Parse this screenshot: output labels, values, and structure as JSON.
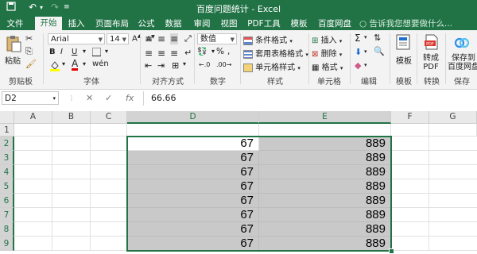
{
  "window": {
    "title": "百度问题统计 - Excel"
  },
  "quick_access": {
    "save_icon": "save-icon",
    "undo_icon": "undo-icon",
    "redo_icon": "redo-icon",
    "customize_icon": "customize-icon"
  },
  "tabs": [
    {
      "label": "文件"
    },
    {
      "label": "开始"
    },
    {
      "label": "插入"
    },
    {
      "label": "页面布局"
    },
    {
      "label": "公式"
    },
    {
      "label": "数据"
    },
    {
      "label": "审阅"
    },
    {
      "label": "视图"
    },
    {
      "label": "PDF工具"
    },
    {
      "label": "模板"
    },
    {
      "label": "百度网盘"
    }
  ],
  "tell_me": "告诉我您想要做什么...",
  "ribbon": {
    "paste_label": "粘贴",
    "font_name": "Arial",
    "font_size": "14",
    "number_format": "数值",
    "percent_symbol": "%",
    "conditional_format": "条件格式",
    "table_format": "套用表格格式",
    "cell_style": "单元格样式",
    "insert": "插入",
    "delete": "删除",
    "format": "格式",
    "template_label": "模板",
    "convert_pdf": "转成\nPDF",
    "save_to_baidu": "保存到\n百度网盘",
    "groups": {
      "clipboard": "剪贴板",
      "font": "字体",
      "alignment": "对齐方式",
      "number": "数字",
      "styles": "样式",
      "cells": "单元格",
      "editing": "编辑",
      "template": "模板",
      "convert": "转换",
      "save": "保存"
    }
  },
  "formula_bar": {
    "name_box": "D2",
    "cancel": "✕",
    "enter": "✓",
    "fx": "fx",
    "value": "66.66"
  },
  "sheet": {
    "columns": [
      "A",
      "B",
      "C",
      "D",
      "E",
      "F",
      "G"
    ],
    "rows": [
      "1",
      "2",
      "3",
      "4",
      "5",
      "6",
      "7",
      "8",
      "9"
    ],
    "data": [
      {
        "row": "2",
        "d": "67",
        "e": "889"
      },
      {
        "row": "3",
        "d": "67",
        "e": "889"
      },
      {
        "row": "4",
        "d": "67",
        "e": "889"
      },
      {
        "row": "5",
        "d": "67",
        "e": "889"
      },
      {
        "row": "6",
        "d": "67",
        "e": "889"
      },
      {
        "row": "7",
        "d": "67",
        "e": "889"
      },
      {
        "row": "8",
        "d": "67",
        "e": "889"
      },
      {
        "row": "9",
        "d": "67",
        "e": "889"
      }
    ],
    "active_cell": "D2",
    "selection": "D2:E9"
  },
  "colors": {
    "accent": "#217346",
    "selection_fill": "#c9c9c9"
  }
}
